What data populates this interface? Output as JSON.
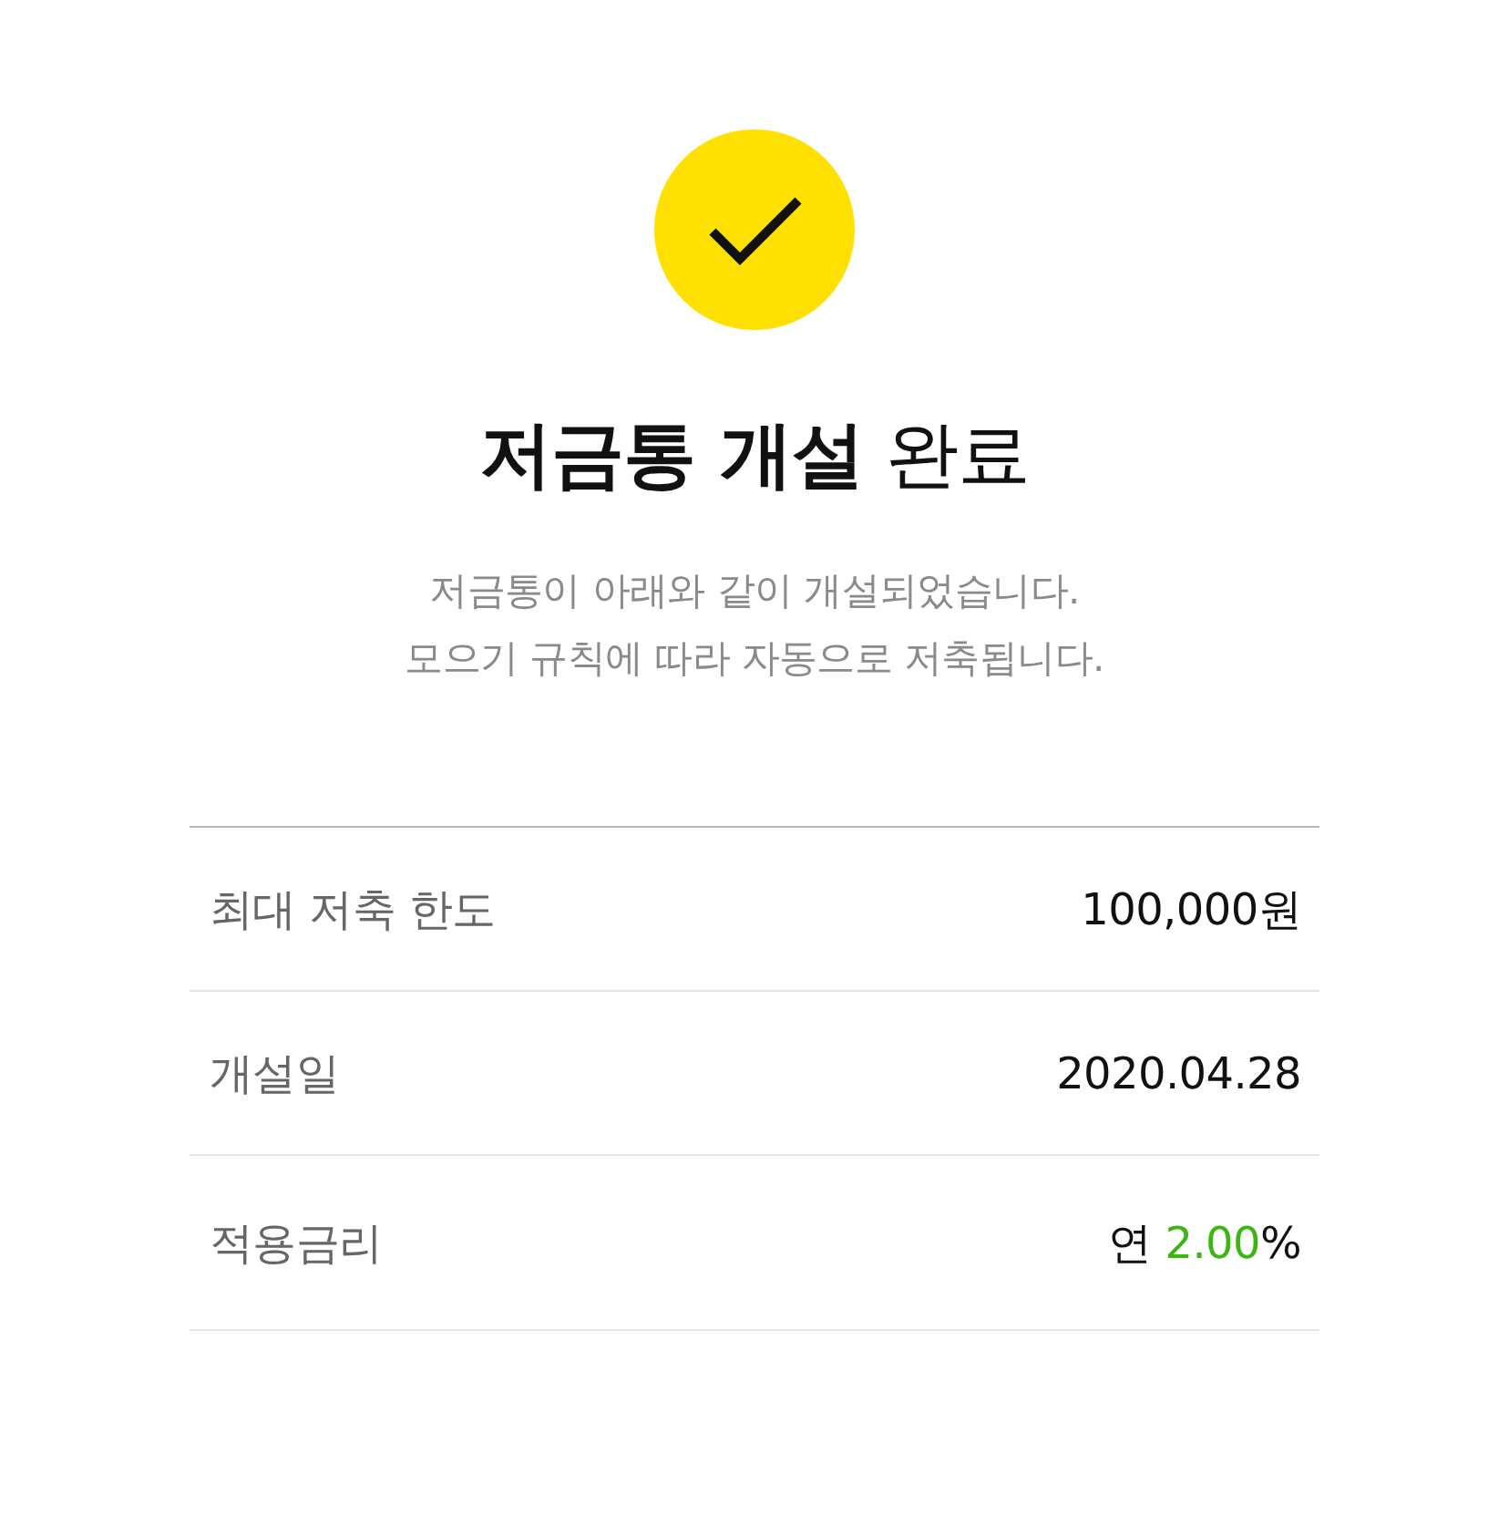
{
  "title": "**저금통 개설** 완료",
  "description": [
    "저금통이 아래와 같이 개설되었습니다.",
    "모으기 규칙에 따라 자동으로 저축됩니다."
  ],
  "details": [
    {
      "kind": "plain",
      "label": "최대 저축 한도",
      "value": "100,000원"
    },
    {
      "kind": "plain",
      "label": "개설일",
      "value": "2020.04.28"
    },
    {
      "kind": "rate",
      "label": "적용금리",
      "prefix": "연",
      "rate": "2.00",
      "suffix": "%"
    }
  ]
}
